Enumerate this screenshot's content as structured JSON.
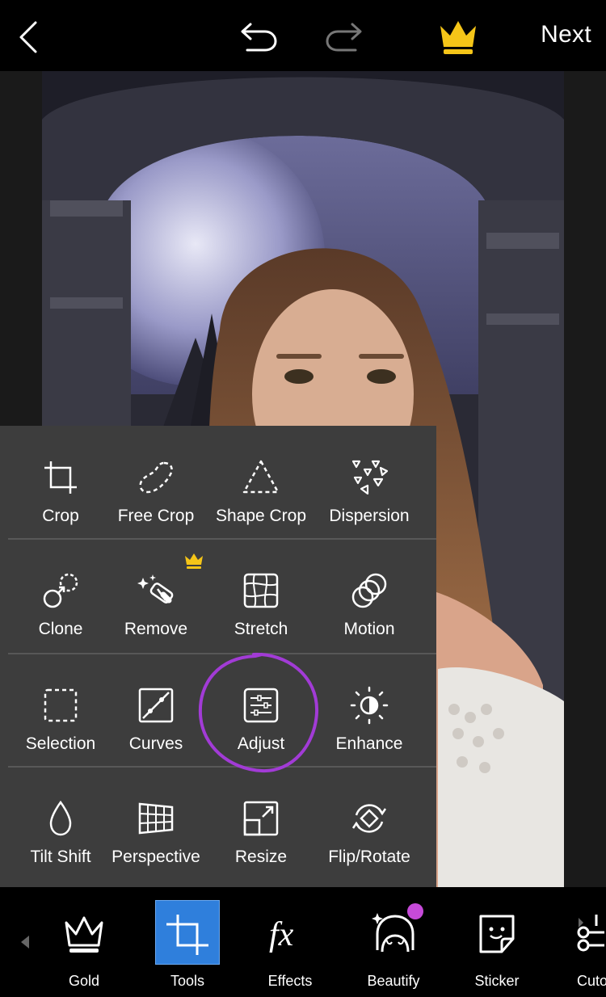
{
  "topbar": {
    "next_label": "Next",
    "icons": [
      "back-arrow-icon",
      "undo-icon",
      "redo-icon",
      "crown-icon"
    ],
    "crown_color": "#f5c518"
  },
  "tools": {
    "row1": [
      {
        "label": "Crop",
        "icon": "crop-icon"
      },
      {
        "label": "Free Crop",
        "icon": "free-crop-icon"
      },
      {
        "label": "Shape Crop",
        "icon": "shape-crop-icon"
      },
      {
        "label": "Dispersion",
        "icon": "dispersion-icon"
      }
    ],
    "row2": [
      {
        "label": "Clone",
        "icon": "clone-icon"
      },
      {
        "label": "Remove",
        "icon": "remove-icon",
        "premium": true
      },
      {
        "label": "Stretch",
        "icon": "stretch-icon"
      },
      {
        "label": "Motion",
        "icon": "motion-icon"
      }
    ],
    "row3": [
      {
        "label": "Selection",
        "icon": "selection-icon"
      },
      {
        "label": "Curves",
        "icon": "curves-icon"
      },
      {
        "label": "Adjust",
        "icon": "adjust-icon",
        "highlighted": true
      },
      {
        "label": "Enhance",
        "icon": "enhance-icon"
      }
    ],
    "row4": [
      {
        "label": "Tilt Shift",
        "icon": "tilt-shift-icon"
      },
      {
        "label": "Perspective",
        "icon": "perspective-icon"
      },
      {
        "label": "Resize",
        "icon": "resize-icon"
      },
      {
        "label": "Flip/Rotate",
        "icon": "flip-rotate-icon"
      }
    ],
    "highlight_color": "#a23bd6"
  },
  "bottombar": {
    "items": [
      {
        "label": "Gold",
        "icon": "gold-crown-icon"
      },
      {
        "label": "Tools",
        "icon": "tools-crop-icon",
        "selected": true
      },
      {
        "label": "Effects",
        "icon": "effects-fx-icon"
      },
      {
        "label": "Beautify",
        "icon": "beautify-face-icon",
        "badge": true
      },
      {
        "label": "Sticker",
        "icon": "sticker-icon"
      },
      {
        "label": "Cuto",
        "icon": "cutout-icon"
      }
    ],
    "selected_color": "#2f7fdc",
    "badge_color": "#c64ad9"
  }
}
